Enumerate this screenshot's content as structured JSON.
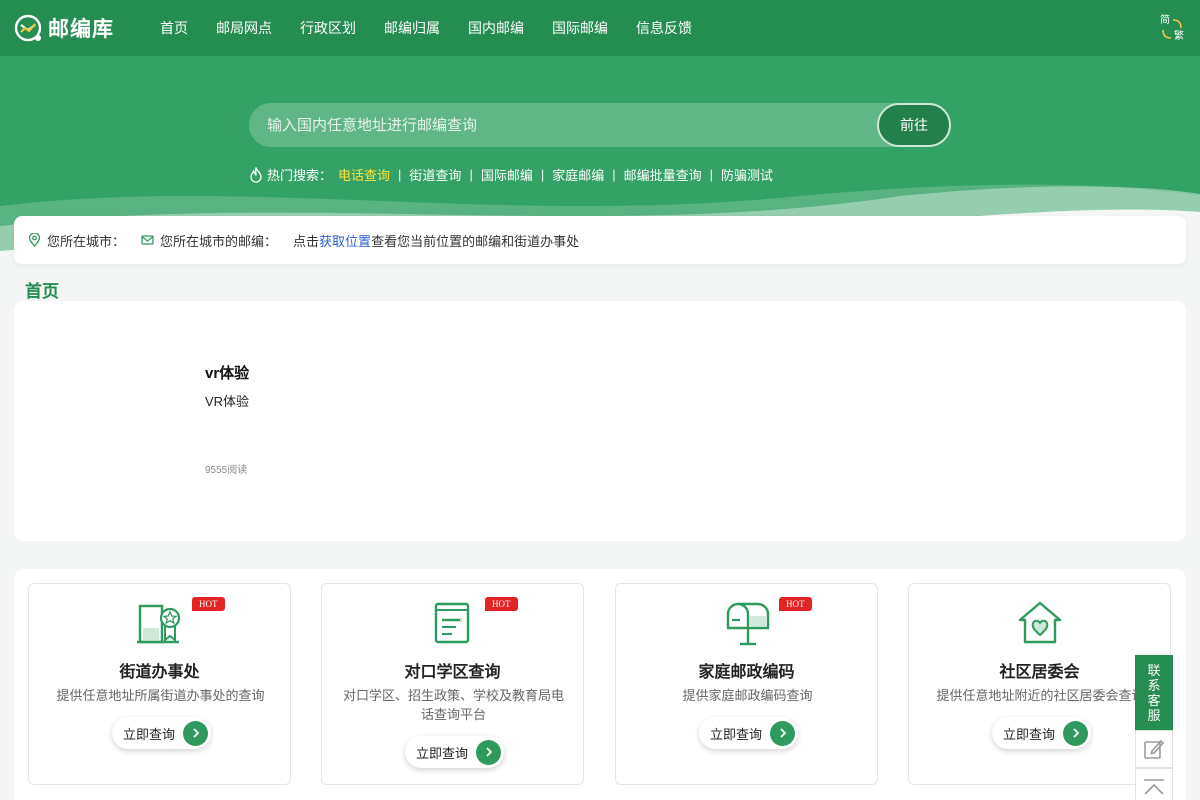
{
  "header": {
    "logo_text": "邮编库",
    "nav": [
      "首页",
      "邮局网点",
      "行政区划",
      "邮编归属",
      "国内邮编",
      "国际邮编",
      "信息反馈"
    ],
    "lang_simplified": "简",
    "lang_traditional": "繁"
  },
  "search": {
    "placeholder": "输入国内任意地址进行邮编查询",
    "button": "前往"
  },
  "hot_search": {
    "label": "热门搜索：",
    "items": [
      "电话查询",
      "街道查询",
      "国际邮编",
      "家庭邮编",
      "邮编批量查询",
      "防骗测试"
    ],
    "active_color": "#ffe13a"
  },
  "location": {
    "city_label": "您所在城市：",
    "zip_label": "您所在城市的邮编：",
    "hint_prefix": "点击",
    "hint_link": "获取位置",
    "hint_suffix": "查看您当前位置的邮编和街道办事处"
  },
  "section_title": "首页",
  "article": {
    "title": "vr体验",
    "desc": "VR体验",
    "reads": "9555阅读"
  },
  "services": [
    {
      "title": "街道办事处",
      "desc": "提供任意地址所属街道办事处的查询",
      "button": "立即查询",
      "badge": "HOT",
      "icon": "street-office-icon"
    },
    {
      "title": "对口学区查询",
      "desc": "对口学区、招生政策、学校及教育局电话查询平台",
      "button": "立即查询",
      "badge": "HOT",
      "icon": "school-district-icon"
    },
    {
      "title": "家庭邮政编码",
      "desc": "提供家庭邮政编码查询",
      "button": "立即查询",
      "badge": "HOT",
      "icon": "mailbox-icon"
    },
    {
      "title": "社区居委会",
      "desc": "提供任意地址附近的社区居委会查询",
      "button": "立即查询",
      "badge": "",
      "icon": "community-house-icon"
    }
  ],
  "float": {
    "kefu": [
      "联",
      "系",
      "客",
      "服"
    ]
  },
  "colors": {
    "brand": "#258c52",
    "hero": "#34a266",
    "hot_badge": "#e32424",
    "link": "#2a62c9"
  }
}
